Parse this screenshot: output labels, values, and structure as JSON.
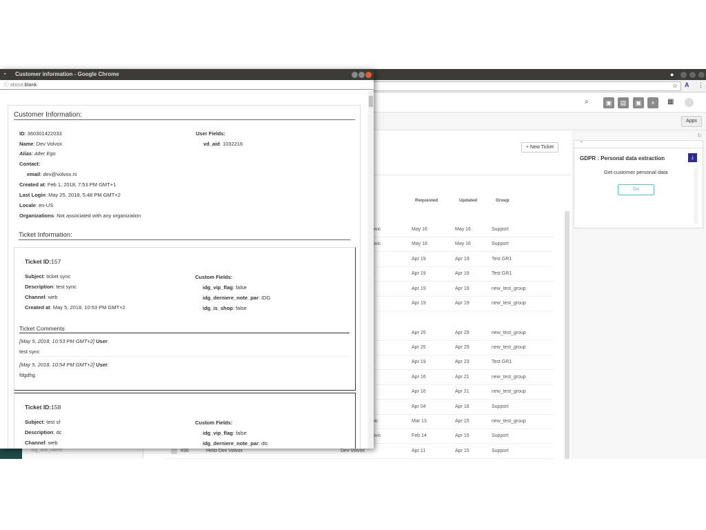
{
  "background_window": {
    "nav_icons": [
      "search-icon",
      "cube-icon",
      "chat-icon",
      "cube-icon",
      "message-icon",
      "grid-icon",
      "avatar-icon"
    ],
    "apps_label": "Apps",
    "new_ticket_label": "+ New Ticket",
    "table": {
      "headers": [
        "Requested",
        "Updated",
        "Group"
      ],
      "rows": [
        {
          "requester": "ovic",
          "requested": "May 16",
          "updated": "May 16",
          "group": "Support"
        },
        {
          "requester": "ovic",
          "requested": "May 16",
          "updated": "May 16",
          "group": "Support"
        },
        {
          "requester": "",
          "requested": "Apr 19",
          "updated": "Apr 19",
          "group": "Test GR1"
        },
        {
          "requester": "",
          "requested": "Apr 19",
          "updated": "Apr 19",
          "group": "Test GR1"
        },
        {
          "requester": "",
          "requested": "Apr 19",
          "updated": "Apr 19",
          "group": "new_test_group"
        },
        {
          "requester": "",
          "requested": "Apr 19",
          "updated": "Apr 19",
          "group": "new_test_group"
        },
        {
          "requester": "",
          "requested": "Apr 25",
          "updated": "Apr 29",
          "group": "new_test_group"
        },
        {
          "requester": "",
          "requested": "Apr 25",
          "updated": "Apr 29",
          "group": "new_test_group"
        },
        {
          "requester": "",
          "requested": "Apr 19",
          "updated": "Apr 23",
          "group": "Test GR1"
        },
        {
          "requester": "",
          "requested": "Apr 16",
          "updated": "Apr 21",
          "group": "new_test_group"
        },
        {
          "requester": "",
          "requested": "Apr 16",
          "updated": "Apr 21",
          "group": "new_test_group"
        },
        {
          "requester": "",
          "requested": "Apr 04",
          "updated": "Apr 16",
          "group": "Support"
        },
        {
          "requester": "vic",
          "requested": "Mar 13",
          "updated": "Apr 15",
          "group": "new_test_group"
        },
        {
          "requester": "ovic",
          "requested": "Feb 14",
          "updated": "Apr 15",
          "group": "Support"
        }
      ],
      "last_row": {
        "id": "#30",
        "subject": "Hello Dev Volvox",
        "requester": "Dev Volvox",
        "requested": "Apr 11",
        "updated": "Apr 15",
        "group": "Support"
      }
    },
    "sidebar_field": "idg_last_name",
    "gdpr": {
      "title": "GDPR : Personal data extraction",
      "description": "Get customer personal data",
      "go_label": "Go",
      "accent": "#2b2d8f"
    }
  },
  "popup": {
    "title": "Customer information - Google Chrome",
    "url_prefix": "about:",
    "url": "blank",
    "customer": {
      "heading": "Customer Information:",
      "id_label": "ID",
      "id": "360301422033",
      "name_label": "Name",
      "name": "Dev Volvox",
      "alias_label": "Alias",
      "alias": "Alter Ego",
      "contact_label": "Contact:",
      "email_label": "email",
      "email": "dev@volvox.rs",
      "created_label": "Created at",
      "created": "Feb 1, 2018, 7:53 PM GMT+1",
      "login_label": "Last Login",
      "login": "May 25, 2018, 5:48 PM GMT+2",
      "locale_label": "Locale",
      "locale": "en-US",
      "org_label": "Organizations",
      "org": "Not associated with any organization",
      "user_fields_label": "User Fields:",
      "vd_aid_label": "vd_aid",
      "vd_aid": "1032216"
    },
    "ticket_heading": "Ticket Information:",
    "tickets": [
      {
        "id_label": "Ticket ID:",
        "id": "157",
        "subject": "ticket sync",
        "description": "test sync",
        "channel": "web",
        "created": "May 5, 2018, 10:53 PM GMT+2",
        "custom": {
          "vip": "false",
          "derniere": "IDG",
          "shop": "false"
        },
        "comments_label": "Ticket Comments",
        "comments": [
          {
            "meta": "[May 5, 2018, 10:53 PM GMT+2]",
            "user": "User",
            "body": "test sync"
          },
          {
            "meta": "[May 5, 2018, 10:54 PM GMT+2]",
            "user": "User",
            "body": "fdgdhg"
          }
        ]
      },
      {
        "id_label": "Ticket ID:",
        "id": "158",
        "subject": "test sf",
        "description": "dc",
        "channel": "web",
        "custom": {
          "vip": "false",
          "derniere": "dtc"
        }
      }
    ],
    "labels": {
      "subject": "Subject",
      "description": "Description",
      "channel": "Channel",
      "created": "Created at",
      "custom": "Custom Fields:",
      "vip": "idg_vip_flag",
      "derniere": "idg_derniere_note_par",
      "shop": "idg_is_shop"
    }
  }
}
